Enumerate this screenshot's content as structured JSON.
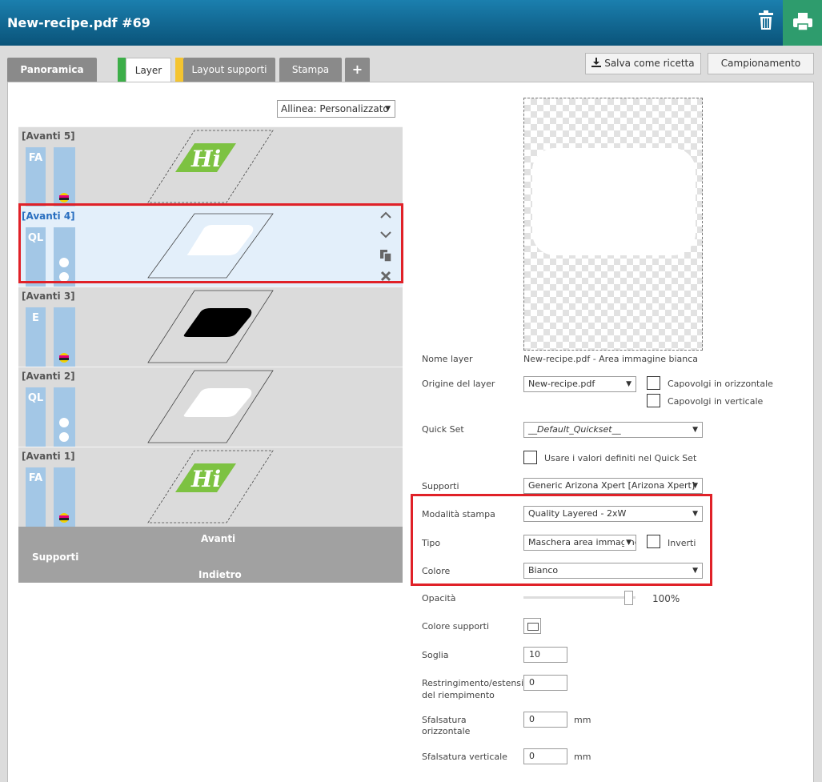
{
  "window": {
    "title": "New-recipe.pdf #69"
  },
  "tabs": [
    {
      "label": "Panoramica"
    },
    {
      "label": "Layer"
    },
    {
      "label": "Layout supporti"
    },
    {
      "label": "Stampa"
    },
    {
      "label": "+"
    }
  ],
  "toolbar": {
    "save_label": "Salva come ricetta",
    "sampling_label": "Campionamento"
  },
  "align": {
    "label": "Allinea: Personalizzato"
  },
  "layers": [
    {
      "label": "[Avanti 5]",
      "code": "FA"
    },
    {
      "label": "[Avanti 4]",
      "code": "QL"
    },
    {
      "label": "[Avanti 3]",
      "code": "E"
    },
    {
      "label": "[Avanti 2]",
      "code": "QL"
    },
    {
      "label": "[Avanti 1]",
      "code": "FA"
    }
  ],
  "media_bar": {
    "supports": "Supporti",
    "front": "Avanti",
    "back": "Indietro"
  },
  "thumb_text": "Hi",
  "properties": {
    "layer_name_label": "Nome layer",
    "layer_name_value": "New-recipe.pdf - Area immagine bianca",
    "origin_label": "Origine del layer",
    "origin_value": "New-recipe.pdf",
    "flip_h": "Capovolgi in orizzontale",
    "flip_v": "Capovolgi in verticale",
    "quickset_label": "Quick Set",
    "quickset_value": "__Default_Quickset__",
    "use_quickset": "Usare i valori definiti nel Quick Set",
    "media_label": "Supporti",
    "media_value": "Generic Arizona Xpert [Arizona Xpert]",
    "print_mode_label": "Modalità stampa",
    "print_mode_value": "Quality Layered - 2xW",
    "type_label": "Tipo",
    "type_value": "Maschera area immagine",
    "invert_label": "Inverti",
    "color_label": "Colore",
    "color_value": "Bianco",
    "opacity_label": "Opacità",
    "opacity_value": "100%",
    "media_color_label": "Colore supporti",
    "threshold_label": "Soglia",
    "threshold_value": "10",
    "fill_label_1": "Restringimento/estensione",
    "fill_label_2": "del riempimento",
    "fill_value": "0",
    "offset_h_label_1": "Sfalsatura",
    "offset_h_label_2": "orizzontale",
    "offset_h_value": "0",
    "offset_h_unit": "mm",
    "offset_v_label": "Sfalsatura verticale",
    "offset_v_value": "0",
    "offset_v_unit": "mm"
  },
  "icons": {
    "trash": "trash-icon",
    "print": "printer-icon",
    "download": "download-icon",
    "up": "chevron-up-icon",
    "down": "chevron-down-icon",
    "copy": "copy-icon",
    "delete": "close-icon"
  },
  "colors": {
    "title_bar": "#0a5379",
    "print_button": "#2e9c6d",
    "tab_green": "#3dae49",
    "tab_yellow": "#f4c430",
    "selection_red": "#e02128",
    "lane_blue": "#a3c7e6",
    "logo_green": "#7dc242"
  }
}
